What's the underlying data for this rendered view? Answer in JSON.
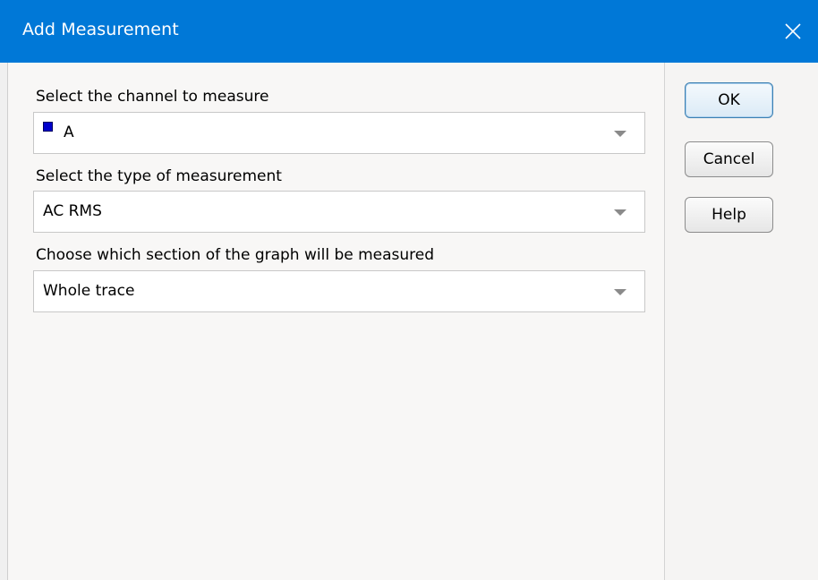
{
  "window": {
    "title": "Add Measurement",
    "close_icon": "close-icon"
  },
  "form": {
    "channel": {
      "label": "Select the channel to measure",
      "value": "A",
      "swatch_color": "#0000cc"
    },
    "measurement_type": {
      "label": "Select the type of measurement",
      "value": "AC RMS"
    },
    "section": {
      "label": "Choose which section of the graph will be measured",
      "value": "Whole trace"
    }
  },
  "buttons": {
    "ok": "OK",
    "cancel": "Cancel",
    "help": "Help"
  },
  "colors": {
    "titlebar": "#0078d7",
    "dropdown_arrow": "#8a8a8a"
  }
}
